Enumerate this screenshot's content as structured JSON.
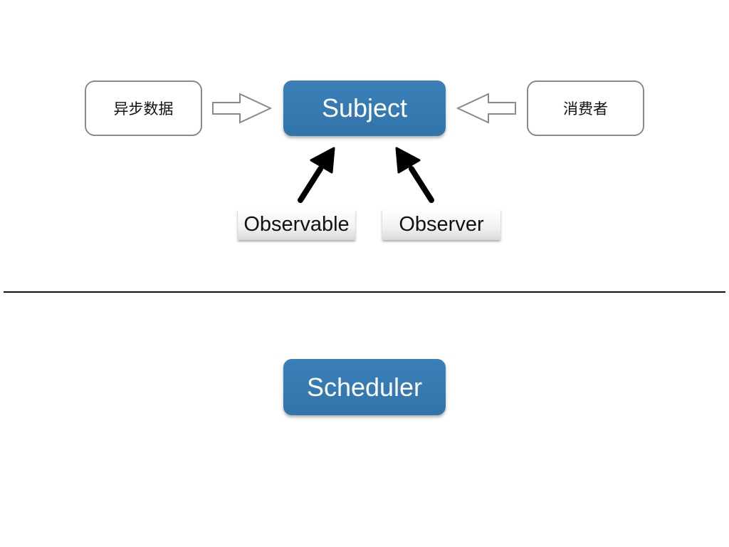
{
  "nodes": {
    "async_data": "异步数据",
    "subject": "Subject",
    "consumer": "消费者",
    "observable": "Observable",
    "observer": "Observer",
    "scheduler": "Scheduler"
  },
  "colors": {
    "primary_box": "#3479b0",
    "outline": "#8a8a8a",
    "arrow": "#000000",
    "divider": "#111111"
  }
}
